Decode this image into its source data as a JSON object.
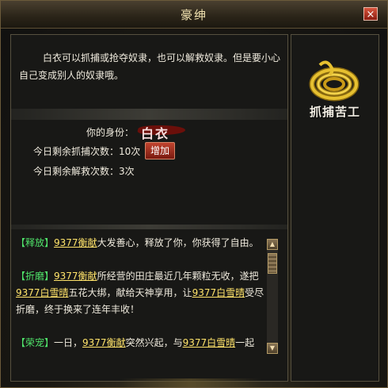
{
  "window": {
    "title": "豪绅",
    "close_label": "×"
  },
  "intro": {
    "text": "白衣可以抓捕或抢夺奴隶，也可以解救奴隶。但是要小心自己变成别人的奴隶哦。"
  },
  "status": {
    "identity_label": "你的身份：",
    "identity_value": "白衣",
    "capture_label": "今日剩余抓捕次数：",
    "capture_count": "10次",
    "increase_label": "增加",
    "rescue_label": "今日剩余解救次数：",
    "rescue_count": "3次"
  },
  "log": {
    "entries": [
      {
        "tag": "【释放】",
        "p1": "",
        "name1": "9377衡献",
        "p2": "大发善心，释放了你，你获得了自由。",
        "name2": "",
        "p3": "",
        "name3": "",
        "p4": ""
      },
      {
        "tag": "【折磨】",
        "p1": "",
        "name1": "9377衡献",
        "p2": "所经营的田庄最近几年颗粒无收，遂把",
        "name2": "9377白雪晴",
        "p3": "五花大绑，献给天神享用，让",
        "name3": "9377白雪晴",
        "p4": "受尽折磨，终于换来了连年丰收！"
      },
      {
        "tag": "【荣宠】",
        "p1": "一日，",
        "name1": "9377衡献",
        "p2": "突然兴起，与",
        "name2": "9377白雪晴",
        "p3": "一起",
        "name3": "",
        "p4": ""
      }
    ]
  },
  "side_panel": {
    "icon": "rope-icon",
    "label": "抓捕苦工"
  },
  "colors": {
    "tag": "#4fe36a",
    "link": "#ffe36a",
    "text": "#f0ebde",
    "accent": "#7a1a10"
  }
}
